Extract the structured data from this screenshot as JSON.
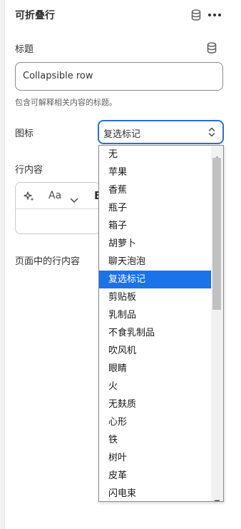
{
  "header": {
    "title": "可折叠行",
    "db_icon": "database-icon",
    "more_icon": "more-horizontal-icon"
  },
  "heading_field": {
    "label": "标题",
    "value": "Collapsible row",
    "help": "包含可解释相关内容的标题。",
    "db_icon": "database-icon"
  },
  "icon_field": {
    "label": "图标",
    "selected": "复选标记",
    "arrows_icon": "select-arrows-icon",
    "options": [
      "无",
      "苹果",
      "香蕉",
      "瓶子",
      "箱子",
      "胡萝卜",
      "聊天泡泡",
      "复选标记",
      "剪贴板",
      "乳制品",
      "不食乳制品",
      "吹风机",
      "眼睛",
      "火",
      "无麸质",
      "心形",
      "铁",
      "树叶",
      "皮革",
      "闪电束"
    ],
    "selected_index": 7
  },
  "row_content": {
    "label": "行内容",
    "toolbar": {
      "magic_icon": "sparkle-icon",
      "text_style": "Aa",
      "chevron_icon": "chevron-down-icon",
      "bold": "B"
    }
  },
  "page_row_content": {
    "label": "页面中的行内容"
  },
  "colors": {
    "accent": "#2c6ecb",
    "selected_option": "#1a73e8"
  }
}
